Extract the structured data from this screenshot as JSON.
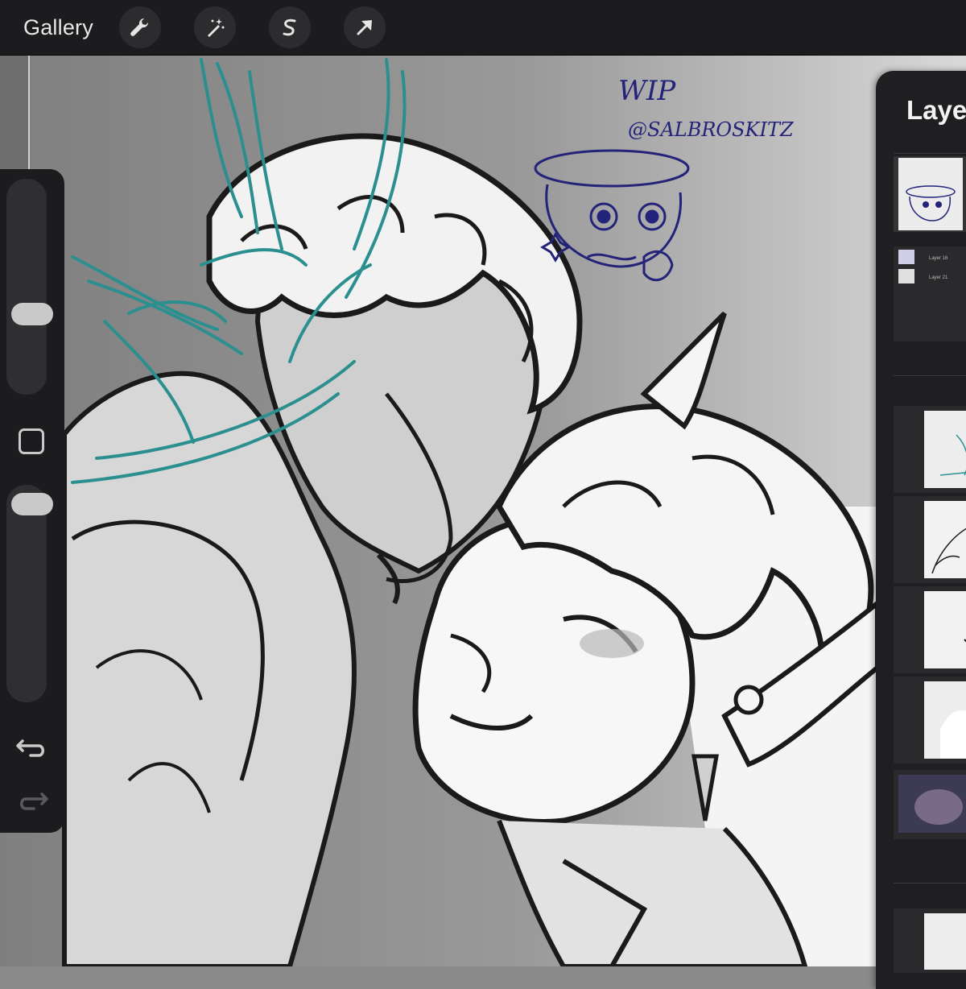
{
  "toolbar": {
    "gallery_label": "Gallery",
    "tools": [
      {
        "name": "actions",
        "icon": "wrench-icon"
      },
      {
        "name": "adjustments",
        "icon": "magic-wand-icon"
      },
      {
        "name": "selection",
        "icon": "selection-s-icon"
      },
      {
        "name": "transform",
        "icon": "transform-arrow-icon"
      }
    ]
  },
  "canvas": {
    "watermark_line1": "WIP",
    "watermark_line2": "@SALBROSKITZ",
    "accent_color": "#2b8f8f",
    "ink_color": "#1a1a1a",
    "doodle_color": "#23237a"
  },
  "sidebar": {
    "brush_size_icon": "brush-size-slider",
    "modify_icon": "modify-square-icon",
    "opacity_icon": "opacity-slider",
    "undo_icon": "undo-icon",
    "redo_icon": "redo-icon"
  },
  "layers_panel": {
    "title": "Layers",
    "group_layers": [
      "Layer 16",
      "Layer 21"
    ]
  }
}
